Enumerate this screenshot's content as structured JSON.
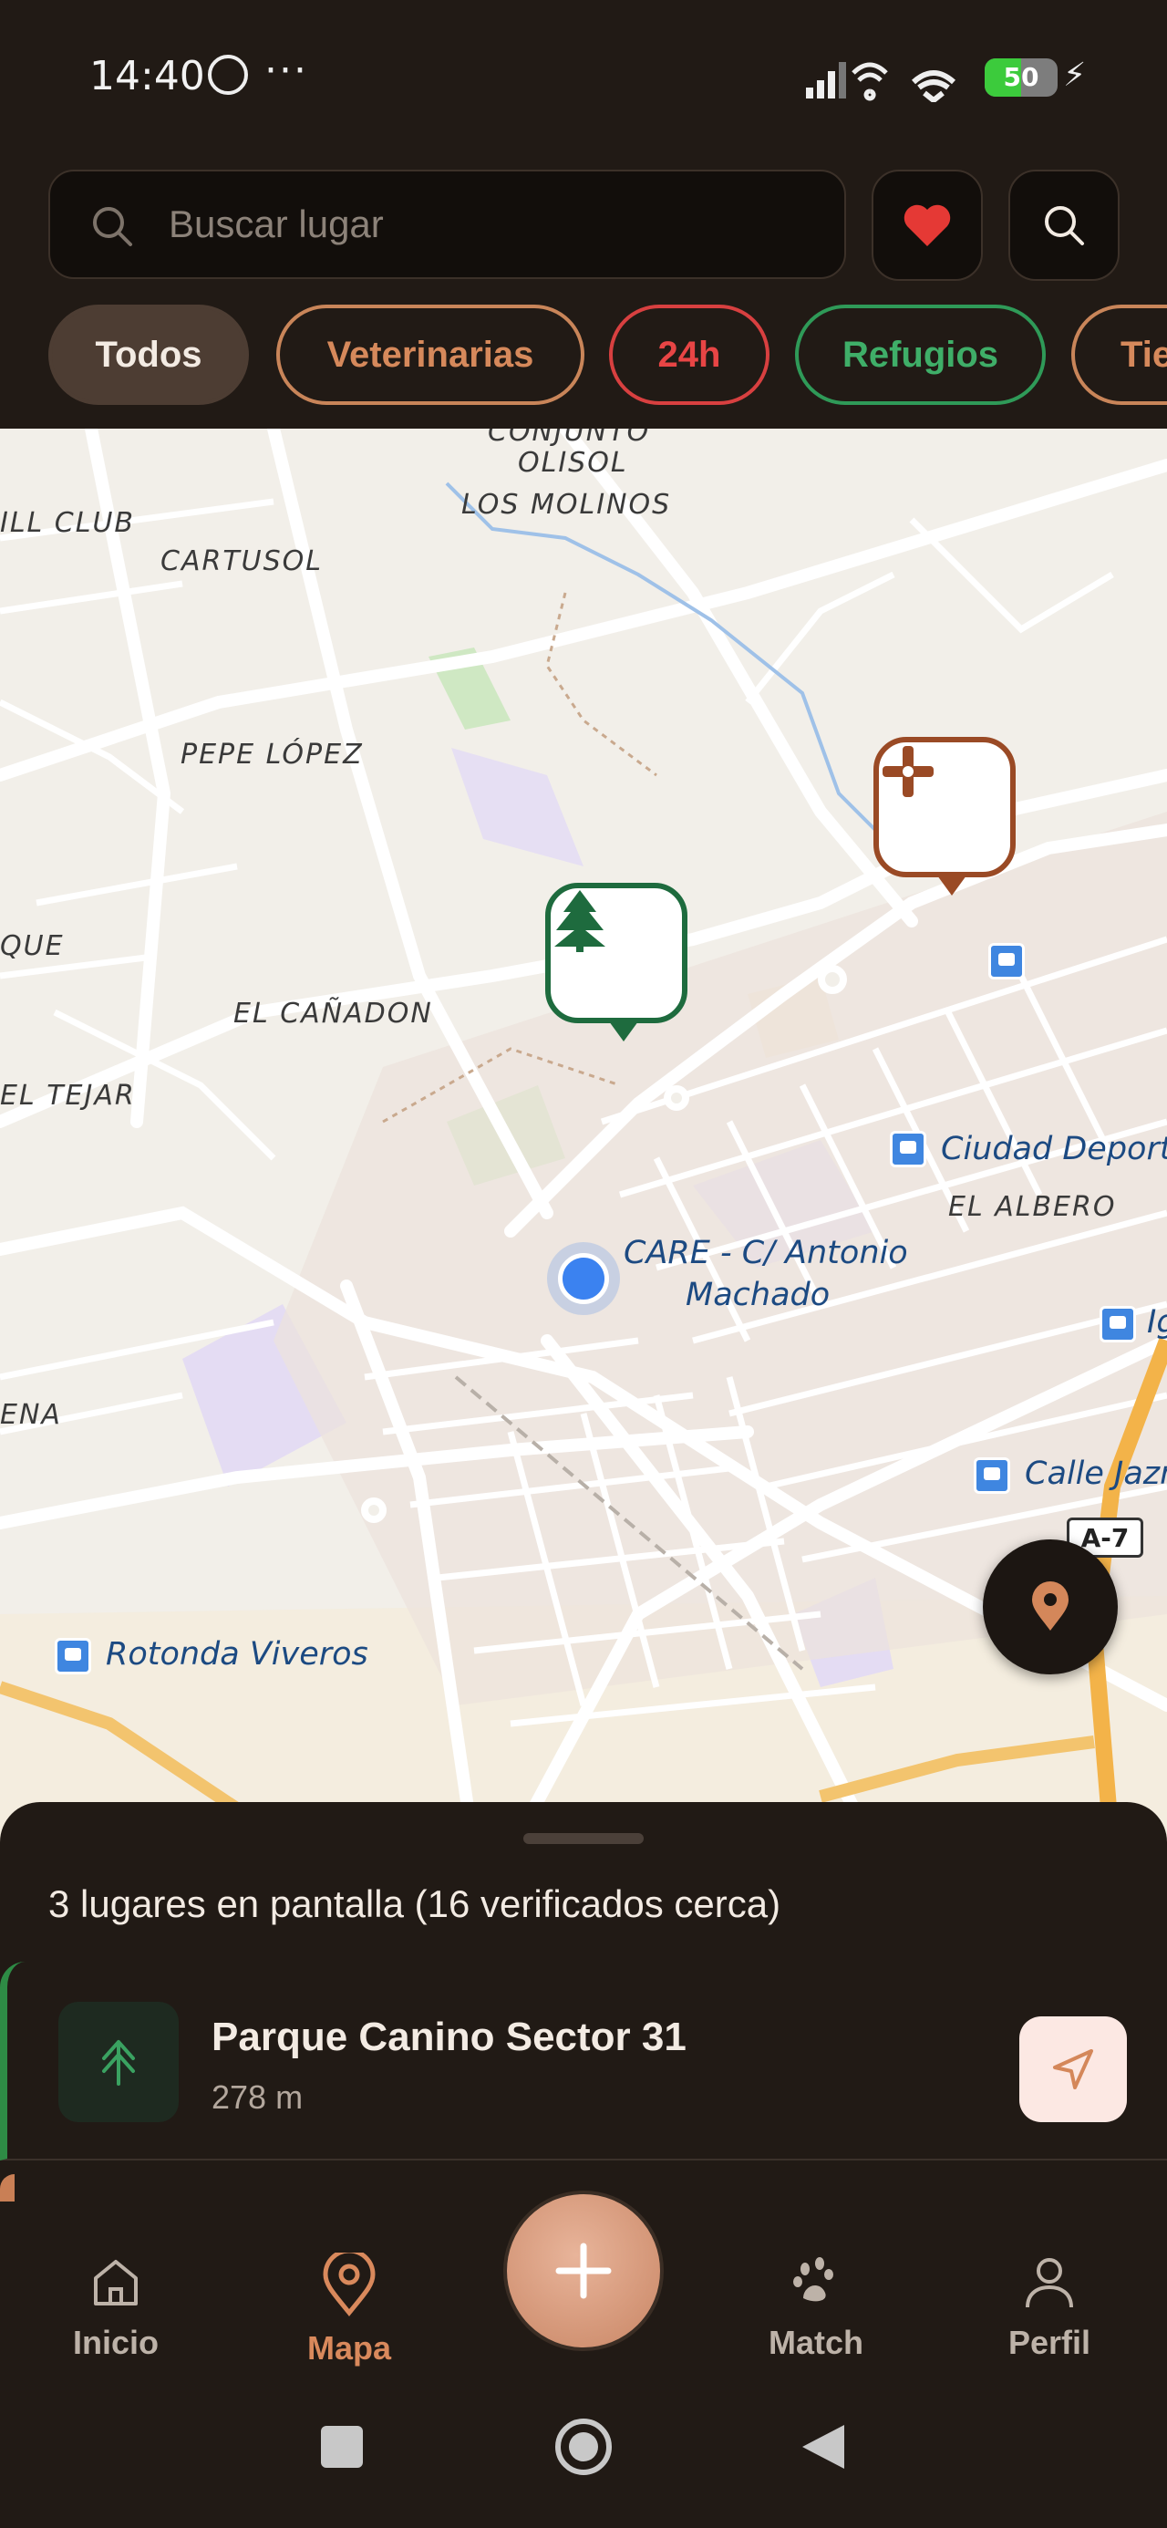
{
  "status_bar": {
    "time": "14:40",
    "battery": "50",
    "battery_level": 0.5
  },
  "search": {
    "placeholder": "Buscar lugar"
  },
  "filters": [
    {
      "label": "Todos",
      "color": "#f3ebe3",
      "border": "#4d3d33",
      "bg": "#4d3d33"
    },
    {
      "label": "Veterinarias",
      "color": "#d6895b",
      "border": "#c98559",
      "bg": "transparent"
    },
    {
      "label": "24h",
      "color": "#e84545",
      "border": "#d84040",
      "bg": "transparent"
    },
    {
      "label": "Refugios",
      "color": "#3fae68",
      "border": "#2f9a58",
      "bg": "transparent"
    },
    {
      "label": "Tiendas",
      "color": "#d6895b",
      "border": "#c98559",
      "bg": "transparent"
    }
  ],
  "map": {
    "labels": {
      "conjunto": "CONJUNTO",
      "olisol": "OLISOL",
      "los_molinos": "LOS MOLINOS",
      "hill_club": "ILL CLUB",
      "cartusol": "CARTUSOL",
      "pepe_lopez": "PEPE LÓPEZ",
      "que": "QUE",
      "el_canadon": "EL CAÑADON",
      "el_tejar": "EL TEJAR",
      "ena": "ENA",
      "el_albero": "EL ALBERO"
    },
    "pois": {
      "ciudad_deportiva": "Ciudad Deporti",
      "care_line1": "CARE - C/ Antonio",
      "care_line2": "Machado",
      "ig": "Ig",
      "calle_jazmin": "Calle Jazn",
      "rotonda_viveros": "Rotonda Viveros"
    },
    "road_shield": "A-7"
  },
  "sheet": {
    "title": "3 lugares en pantalla (16 verificados cerca)",
    "places": [
      {
        "name": "Parque Canino Sector 31",
        "distance": "278 m"
      }
    ]
  },
  "nav": {
    "items": [
      {
        "label": "Inicio"
      },
      {
        "label": "Mapa"
      },
      {
        "label": "Match"
      },
      {
        "label": "Perfil"
      }
    ]
  },
  "colors": {
    "accent": "#d9895c",
    "background": "#211a15",
    "park_green": "#1e6b3e",
    "vet_brown": "#9a4a25"
  }
}
